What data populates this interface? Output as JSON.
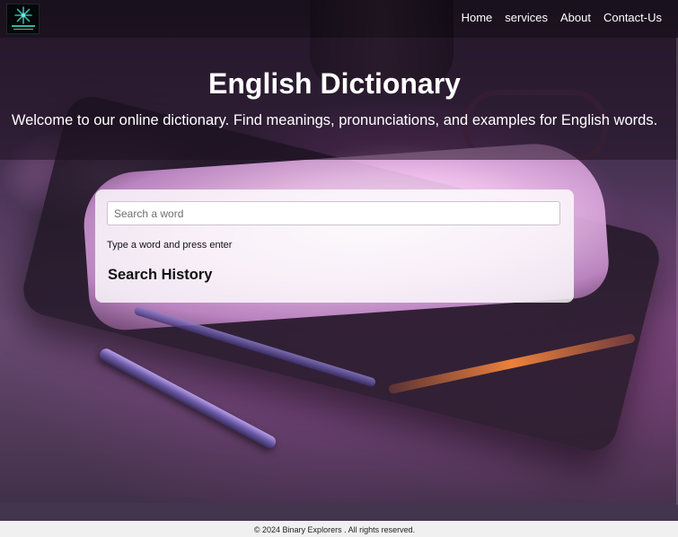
{
  "nav": {
    "links": [
      {
        "label": "Home"
      },
      {
        "label": "services"
      },
      {
        "label": "About"
      },
      {
        "label": "Contact-Us"
      }
    ]
  },
  "hero": {
    "title": "English Dictionary",
    "subtitle": "Welcome to our online dictionary. Find meanings, pronunciations, and examples for English words."
  },
  "search": {
    "placeholder": "Search a word",
    "value": "",
    "hint": "Type a word and press enter"
  },
  "history": {
    "title": "Search History",
    "items": []
  },
  "footer": {
    "text": "© 2024 Binary Explorers . All rights reserved."
  },
  "colors": {
    "accent": "#2fb6a8",
    "nav_background": "#0a060c",
    "footer_background": "#f0f0f0"
  },
  "icons": {
    "logo": "binary-explorers-logo-icon"
  }
}
